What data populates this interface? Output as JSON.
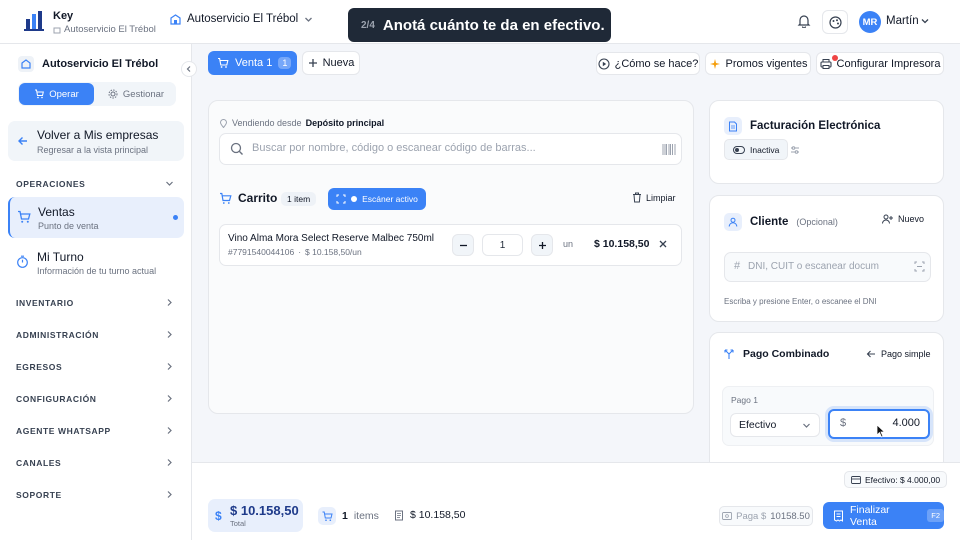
{
  "app": {
    "name": "Key",
    "subtitle": "Autoservicio El Trébol",
    "store_selector": "Autoservicio El Trébol"
  },
  "toast": {
    "step": "2/4",
    "message": "Anotá cuánto te da en efectivo."
  },
  "user": {
    "initials": "MR",
    "name": "Martín",
    "avatar_color": "#3b82f6"
  },
  "sidebar": {
    "store": "Autoservicio El Trébol",
    "mode_operar": "Operar",
    "mode_gestionar": "Gestionar",
    "back": {
      "title": "Volver a Mis empresas",
      "subtitle": "Regresar a la vista principal"
    },
    "operaciones": "OPERACIONES",
    "ventas": {
      "title": "Ventas",
      "subtitle": "Punto de venta"
    },
    "turno": {
      "title": "Mi Turno",
      "subtitle": "Información de tu turno actual"
    },
    "sections": [
      "INVENTARIO",
      "ADMINISTRACIÓN",
      "EGRESOS",
      "CONFIGURACIÓN",
      "AGENTE WHATSAPP",
      "CANALES",
      "SOPORTE"
    ]
  },
  "actions": {
    "tab_label": "Venta 1",
    "tab_badge": "1",
    "new_label": "Nueva",
    "como": "¿Cómo se hace?",
    "promos": "Promos vigentes",
    "impresora": "Configurar Impresora"
  },
  "main": {
    "vendiendo_label": "Vendiendo desde",
    "vendiendo_value": "Depósito principal",
    "search_placeholder": "Buscar por nombre, código o escanear código de barras...",
    "cart_title": "Carrito",
    "cart_count": "1 item",
    "scanner": "Escáner activo",
    "clear": "Limpiar",
    "item": {
      "name": "Vino Alma Mora Select Reserve Malbec 750ml",
      "code": "#7791540044106",
      "sep": "·",
      "unit_price": "$ 10.158,50/un",
      "qty": "1",
      "unit": "un",
      "total": "$ 10.158,50"
    }
  },
  "facturacion": {
    "title": "Facturación Electrónica",
    "status": "Inactiva"
  },
  "cliente": {
    "title": "Cliente",
    "optional": "(Opcional)",
    "new": "Nuevo",
    "placeholder": "DNI, CUIT o escanear docum",
    "hint": "Escriba y presione Enter, o escanee el DNI"
  },
  "pago": {
    "title": "Pago Combinado",
    "simple": "Pago simple",
    "label": "Pago 1",
    "method": "Efectivo",
    "currency": "$",
    "amount": "4.000"
  },
  "bottom": {
    "efectivo": "Efectivo: $ 4.000,00",
    "total_value": "$ 10.158,50",
    "total_label": "Total",
    "items_count": "1",
    "items_label": "items",
    "subtotal": "$ 10.158,50",
    "paga_label": "Paga $",
    "paga_value": "10158.50",
    "finalize": "Finalizar Venta",
    "shortcut": "F2"
  },
  "colors": {
    "accent": "#3b82f6",
    "toast_bg": "#1f2937",
    "notify": "#ef4444"
  }
}
